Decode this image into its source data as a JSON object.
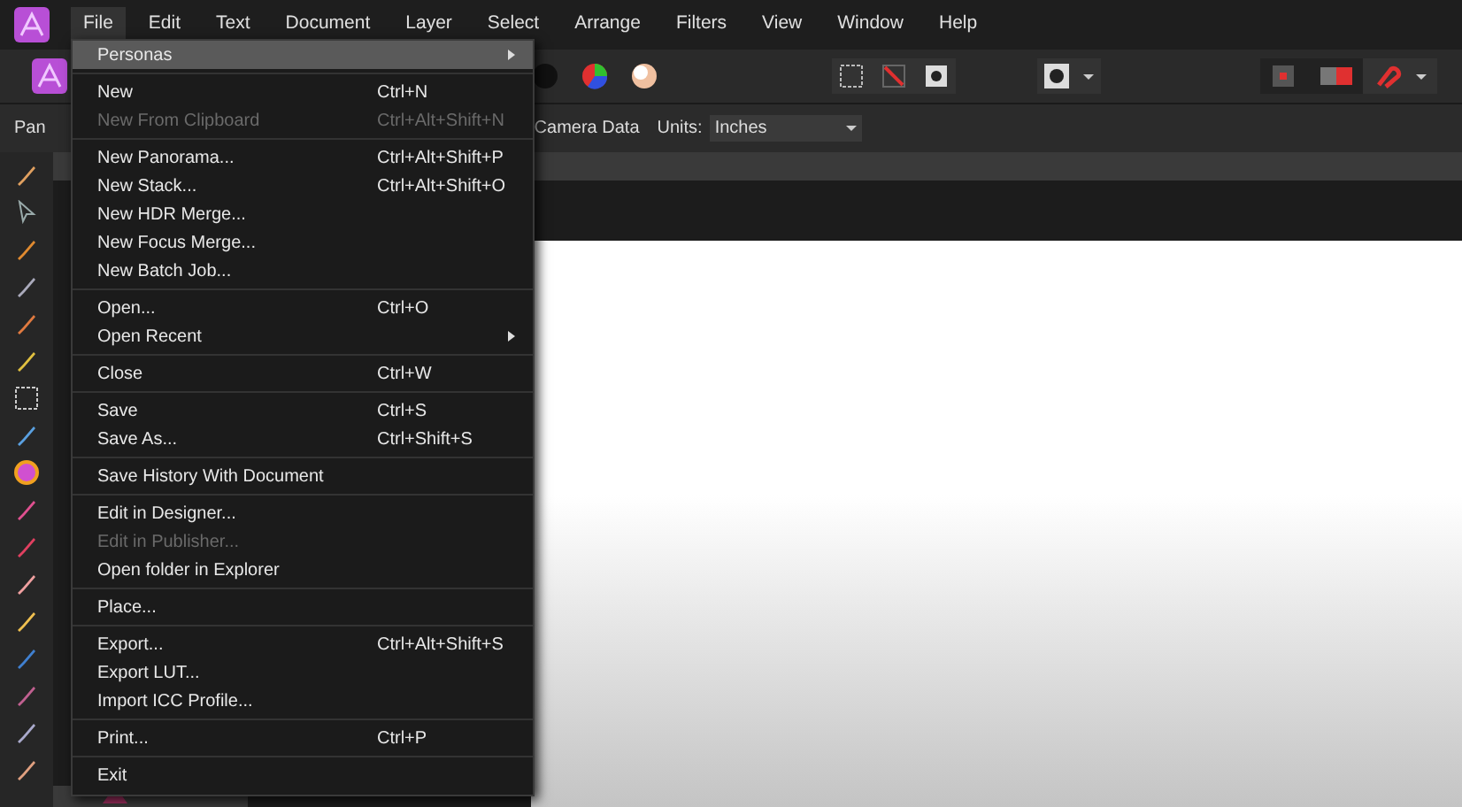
{
  "menubar": [
    {
      "label": "File",
      "selected": true
    },
    {
      "label": "Edit",
      "selected": false
    },
    {
      "label": "Text",
      "selected": false
    },
    {
      "label": "Document",
      "selected": false
    },
    {
      "label": "Layer",
      "selected": false
    },
    {
      "label": "Select",
      "selected": false
    },
    {
      "label": "Arrange",
      "selected": false
    },
    {
      "label": "Filters",
      "selected": false
    },
    {
      "label": "View",
      "selected": false
    },
    {
      "label": "Window",
      "selected": false
    },
    {
      "label": "Help",
      "selected": false
    }
  ],
  "context_bar": {
    "tool": "Pan",
    "camera_data": "Camera Data",
    "units_label": "Units:",
    "units_value": "Inches"
  },
  "file_menu": [
    [
      {
        "label": "Personas",
        "submenu": true,
        "disabled": false,
        "selected": true
      }
    ],
    [
      {
        "label": "New",
        "shortcut": "Ctrl+N",
        "submenu": false,
        "disabled": false,
        "selected": false
      },
      {
        "label": "New From Clipboard",
        "shortcut": "Ctrl+Alt+Shift+N",
        "submenu": false,
        "disabled": true,
        "selected": false
      }
    ],
    [
      {
        "label": "New Panorama...",
        "shortcut": "Ctrl+Alt+Shift+P",
        "submenu": false,
        "disabled": false,
        "selected": false
      },
      {
        "label": "New Stack...",
        "shortcut": "Ctrl+Alt+Shift+O",
        "submenu": false,
        "disabled": false,
        "selected": false
      },
      {
        "label": "New HDR Merge...",
        "submenu": false,
        "disabled": false,
        "selected": false
      },
      {
        "label": "New Focus Merge...",
        "submenu": false,
        "disabled": false,
        "selected": false
      },
      {
        "label": "New Batch Job...",
        "submenu": false,
        "disabled": false,
        "selected": false
      }
    ],
    [
      {
        "label": "Open...",
        "shortcut": "Ctrl+O",
        "submenu": false,
        "disabled": false,
        "selected": false
      },
      {
        "label": "Open Recent",
        "submenu": true,
        "disabled": false,
        "selected": false
      }
    ],
    [
      {
        "label": "Close",
        "shortcut": "Ctrl+W",
        "submenu": false,
        "disabled": false,
        "selected": false
      }
    ],
    [
      {
        "label": "Save",
        "shortcut": "Ctrl+S",
        "submenu": false,
        "disabled": false,
        "selected": false
      },
      {
        "label": "Save As...",
        "shortcut": "Ctrl+Shift+S",
        "submenu": false,
        "disabled": false,
        "selected": false
      }
    ],
    [
      {
        "label": "Save History With Document",
        "submenu": false,
        "disabled": false,
        "selected": false
      }
    ],
    [
      {
        "label": "Edit in Designer...",
        "submenu": false,
        "disabled": false,
        "selected": false
      },
      {
        "label": "Edit in Publisher...",
        "submenu": false,
        "disabled": true,
        "selected": false
      },
      {
        "label": "Open folder in Explorer",
        "submenu": false,
        "disabled": false,
        "selected": false
      }
    ],
    [
      {
        "label": "Place...",
        "submenu": false,
        "disabled": false,
        "selected": false
      }
    ],
    [
      {
        "label": "Export...",
        "shortcut": "Ctrl+Alt+Shift+S",
        "submenu": false,
        "disabled": false,
        "selected": false
      },
      {
        "label": "Export LUT...",
        "submenu": false,
        "disabled": false,
        "selected": false
      },
      {
        "label": "Import ICC Profile...",
        "submenu": false,
        "disabled": false,
        "selected": false
      }
    ],
    [
      {
        "label": "Print...",
        "shortcut": "Ctrl+P",
        "submenu": false,
        "disabled": false,
        "selected": false
      }
    ],
    [
      {
        "label": "Exit",
        "submenu": false,
        "disabled": false,
        "selected": false
      }
    ]
  ]
}
